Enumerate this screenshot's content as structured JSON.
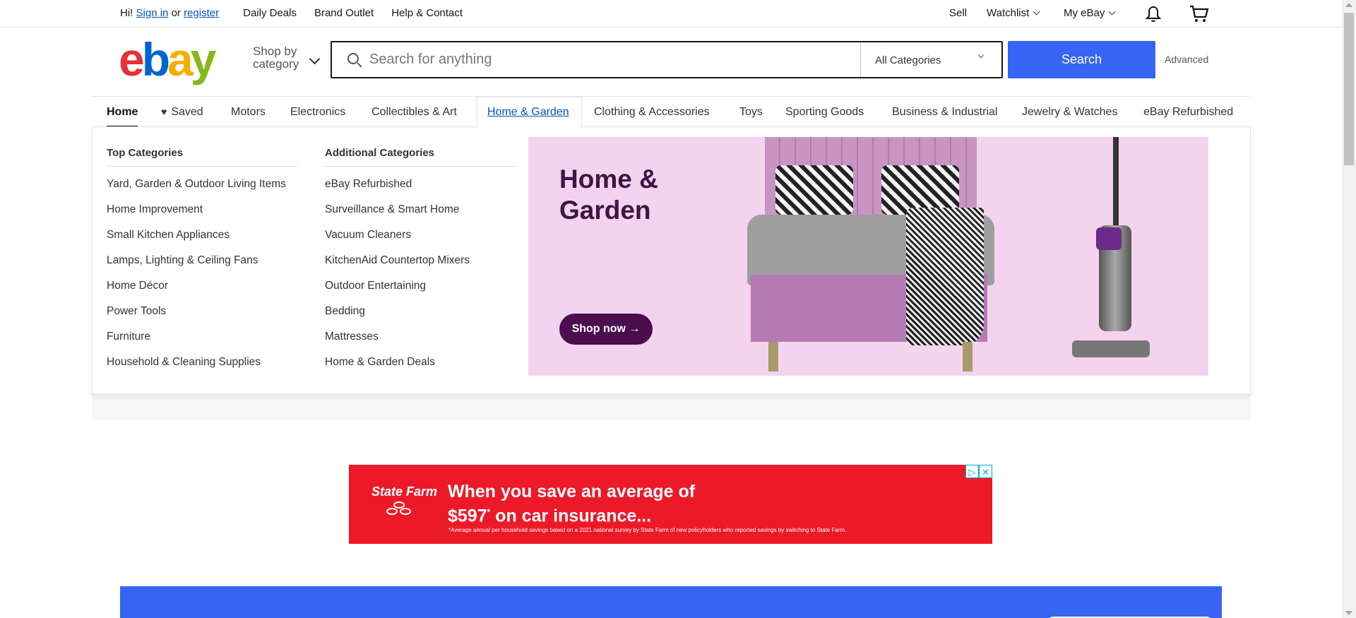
{
  "topbar": {
    "greeting": "Hi!",
    "sign_in": "Sign in",
    "or": "or",
    "register": "register",
    "links": [
      "Daily Deals",
      "Brand Outlet",
      "Help & Contact"
    ],
    "sell": "Sell",
    "watchlist": "Watchlist",
    "my_ebay": "My eBay"
  },
  "header": {
    "logo_letters": [
      "e",
      "b",
      "a",
      "y"
    ],
    "shop_by_line1": "Shop by",
    "shop_by_line2": "category",
    "search_placeholder": "Search for anything",
    "category_select": "All Categories",
    "search_button": "Search",
    "advanced": "Advanced"
  },
  "nav": {
    "items": [
      "Home",
      "Saved",
      "Motors",
      "Electronics",
      "Collectibles & Art",
      "Home & Garden",
      "Clothing & Accessories",
      "Toys",
      "Sporting Goods",
      "Business & Industrial",
      "Jewelry & Watches",
      "eBay Refurbished"
    ]
  },
  "mega": {
    "top_title": "Top Categories",
    "top_items": [
      "Yard, Garden & Outdoor Living Items",
      "Home Improvement",
      "Small Kitchen Appliances",
      "Lamps, Lighting & Ceiling Fans",
      "Home Décor",
      "Power Tools",
      "Furniture",
      "Household & Cleaning Supplies"
    ],
    "additional_title": "Additional Categories",
    "additional_items": [
      "eBay Refurbished",
      "Surveillance & Smart Home",
      "Vacuum Cleaners",
      "KitchenAid Countertop Mixers",
      "Outdoor Entertaining",
      "Bedding",
      "Mattresses",
      "Home & Garden Deals"
    ],
    "banner_line1": "Home &",
    "banner_line2": "Garden",
    "shop_now": "Shop now →"
  },
  "ad": {
    "brand": "State Farm",
    "headline_line1": "When you save an average of",
    "headline_line2_amount": "$597",
    "headline_line2_star": "*",
    "headline_line2_rest": " on car insurance...",
    "fine_print": "*Average annual per household savings based on a 2021 national survey by State Farm of new policyholders who reported savings by switching to State Farm.",
    "adchoices": "▷",
    "close": "✕"
  },
  "colors": {
    "ebay_red": "#e53238",
    "ebay_blue": "#0064d2",
    "ebay_yellow": "#f5af02",
    "ebay_green": "#86b817",
    "search_button": "#3665f3",
    "ad_red": "#ec1a28",
    "banner_bg": "#f4d3ee"
  }
}
